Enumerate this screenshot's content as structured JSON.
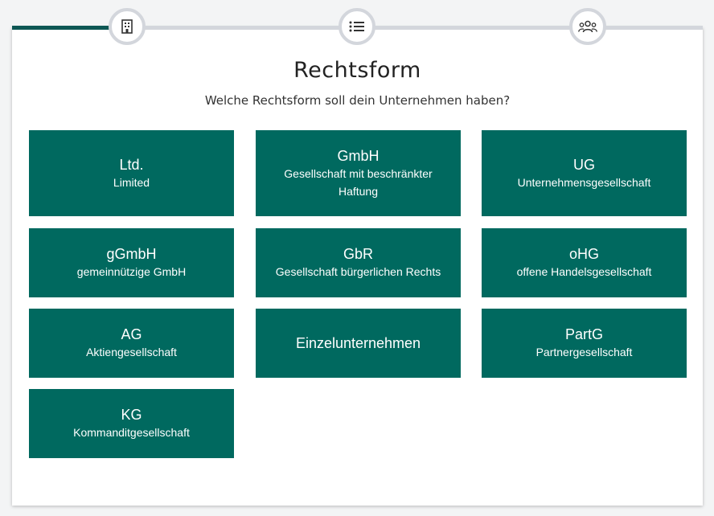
{
  "header": {
    "title": "Rechtsform",
    "subtitle": "Welche Rechtsform soll dein Unternehmen haben?"
  },
  "stepper": {
    "steps": [
      {
        "icon": "building-icon"
      },
      {
        "icon": "list-icon"
      },
      {
        "icon": "users-icon"
      }
    ],
    "colors": {
      "active": "#0d5754",
      "inactive": "#d3d6dc"
    }
  },
  "options": [
    {
      "abbr": "Ltd.",
      "name": "Limited"
    },
    {
      "abbr": "GmbH",
      "name": "Gesellschaft mit beschränkter Haftung"
    },
    {
      "abbr": "UG",
      "name": "Unternehmensgesellschaft"
    },
    {
      "abbr": "gGmbH",
      "name": "gemeinnützige GmbH"
    },
    {
      "abbr": "GbR",
      "name": "Gesellschaft bürgerlichen Rechts"
    },
    {
      "abbr": "oHG",
      "name": "offene Handelsgesellschaft"
    },
    {
      "abbr": "AG",
      "name": "Aktiengesellschaft"
    },
    {
      "abbr": "Einzelunternehmen",
      "name": ""
    },
    {
      "abbr": "PartG",
      "name": "Partnergesellschaft"
    },
    {
      "abbr": "KG",
      "name": "Kommanditgesellschaft"
    }
  ],
  "colors": {
    "tile": "#00695f",
    "text": "#ffffff"
  }
}
